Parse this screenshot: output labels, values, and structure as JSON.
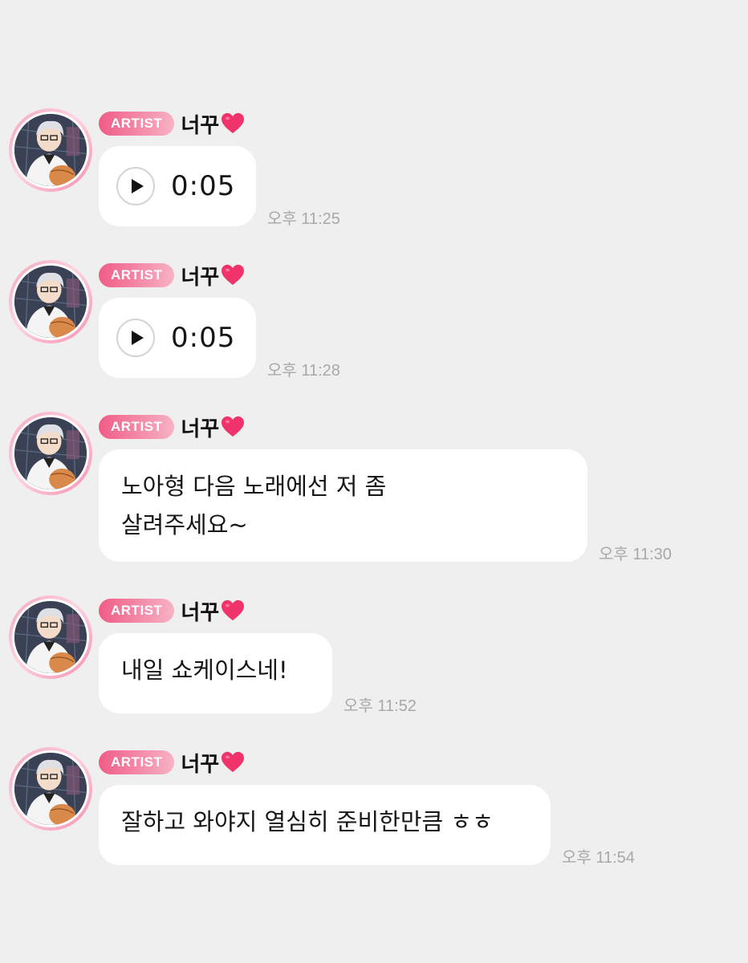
{
  "messages": [
    {
      "badge": "ARTIST",
      "sender": "너꾸",
      "type": "voice",
      "duration": "0:05",
      "time": "오후 11:25"
    },
    {
      "badge": "ARTIST",
      "sender": "너꾸",
      "type": "voice",
      "duration": "0:05",
      "time": "오후 11:28"
    },
    {
      "badge": "ARTIST",
      "sender": "너꾸",
      "type": "text",
      "text": "노아형 다음 노래에선 저 좀\n살려주세요~",
      "time": "오후 11:30"
    },
    {
      "badge": "ARTIST",
      "sender": "너꾸",
      "type": "text",
      "text": "내일 쇼케이스네!",
      "time": "오후 11:52"
    },
    {
      "badge": "ARTIST",
      "sender": "너꾸",
      "type": "text",
      "text": "잘하고 와야지 열심히 준비한만큼 ㅎㅎ",
      "time": "오후 11:54"
    }
  ],
  "icons": {
    "sender_suffix": "heart-icon",
    "voice_control": "play-icon"
  },
  "colors": {
    "background": "#efefef",
    "bubble": "#ffffff",
    "badge_start": "#f05c86",
    "badge_end": "#f7b2c5",
    "heart": "#f0336a",
    "timestamp": "#a8a8a8",
    "avatar_ring": "#f4a3bd"
  }
}
